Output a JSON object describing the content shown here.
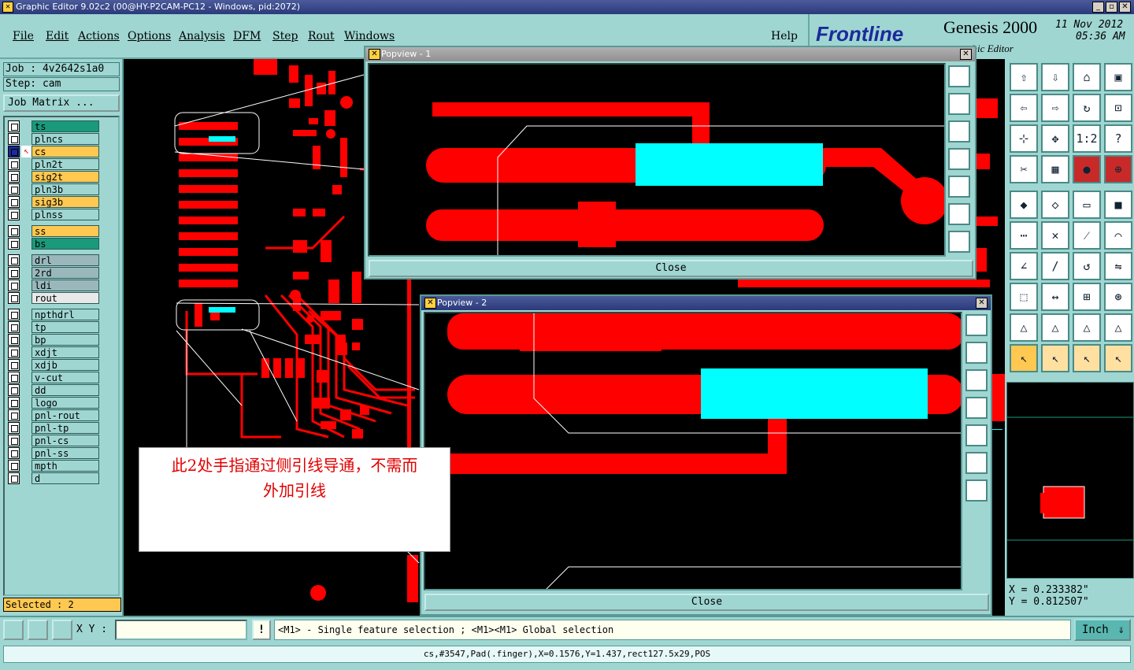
{
  "window": {
    "title": "Graphic Editor 9.02c2 (00@HY-P2CAM-PC12 - Windows, pid:2072)"
  },
  "menu": {
    "items": [
      "File",
      "Edit",
      "Actions",
      "Options",
      "Analysis",
      "DFM",
      "Step",
      "Rout",
      "Windows"
    ],
    "help": "Help"
  },
  "brand": {
    "frontline": "Frontline",
    "genesis": "Genesis 2000",
    "subtitle": "phic Editor",
    "date": "11 Nov 2012",
    "time": "05:36 AM"
  },
  "job": {
    "job_line": "Job : 4v2642s1a0",
    "step_line": "Step: cam",
    "matrix_button": "Job Matrix ..."
  },
  "layers": [
    {
      "name": "ts",
      "color": "#1a9a7a"
    },
    {
      "name": "plncs",
      "color": "#9fd6d2"
    },
    {
      "name": "cs",
      "color": "#ffc850",
      "active": true
    },
    {
      "name": "pln2t",
      "color": "#9fd6d2"
    },
    {
      "name": "sig2t",
      "color": "#ffc850"
    },
    {
      "name": "pln3b",
      "color": "#9fd6d2"
    },
    {
      "name": "sig3b",
      "color": "#ffc850"
    },
    {
      "name": "plnss",
      "color": "#9fd6d2"
    },
    {
      "name": "ss",
      "color": "#ffc850"
    },
    {
      "name": "bs",
      "color": "#1a9a7a"
    },
    {
      "name": "drl",
      "color": "#9ab8bc"
    },
    {
      "name": "2rd",
      "color": "#9ab8bc"
    },
    {
      "name": "ldi",
      "color": "#9ab8bc"
    },
    {
      "name": "rout",
      "color": "#e8e8e8"
    },
    {
      "name": "npthdrl",
      "color": "#9fd6d2"
    },
    {
      "name": "tp",
      "color": "#9fd6d2"
    },
    {
      "name": "bp",
      "color": "#9fd6d2"
    },
    {
      "name": "xdjt",
      "color": "#9fd6d2"
    },
    {
      "name": "xdjb",
      "color": "#9fd6d2"
    },
    {
      "name": "v-cut",
      "color": "#9fd6d2"
    },
    {
      "name": "dd",
      "color": "#9fd6d2"
    },
    {
      "name": "logo",
      "color": "#9fd6d2"
    },
    {
      "name": "pnl-rout",
      "color": "#9fd6d2"
    },
    {
      "name": "pnl-tp",
      "color": "#9fd6d2"
    },
    {
      "name": "pnl-cs",
      "color": "#9fd6d2"
    },
    {
      "name": "pnl-ss",
      "color": "#9fd6d2"
    },
    {
      "name": "mpth",
      "color": "#9fd6d2"
    },
    {
      "name": "d",
      "color": "#9fd6d2"
    }
  ],
  "selected": "Selected : 2",
  "popup1": {
    "title": "Popview - 1",
    "close": "Close"
  },
  "popup2": {
    "title": "Popview - 2",
    "close": "Close"
  },
  "annotation": {
    "line1": "此2处手指通过侧引线导通，不需而",
    "line2": "外加引线"
  },
  "toolbar_icons": [
    "home-icon",
    "arrow-down-icon",
    "house-icon",
    "window-icon",
    "arrow-left-icon",
    "arrow-right-icon",
    "redraw-icon",
    "snap-icon",
    "fit-icon",
    "center-icon",
    "scale-1-2-icon",
    "help-icon",
    "measure-icon",
    "grid-icon",
    "layers-icon",
    "layer-settings-icon",
    "pad-icon",
    "shape-icon",
    "ruler-icon",
    "dot-icon",
    "net-icon",
    "cross-icon",
    "line-icon",
    "arc-icon",
    "angle-icon",
    "slash-icon",
    "rotate-icon",
    "mirror-icon",
    "select-icon",
    "arrow-icon",
    "box-icon",
    "circles-icon",
    "triangle-icon",
    "triangle2-icon",
    "triangle3-icon",
    "triangle4-icon",
    "pointer-icon",
    "pointer2-icon",
    "pointer3-icon",
    "pointer4-icon"
  ],
  "coords": {
    "x": "X = 0.233382\"",
    "y": "Y = 0.812507\""
  },
  "cmdbar": {
    "xy_label": "X Y :",
    "xy_value": "",
    "warn": "!",
    "hint": "<M1> - Single feature selection ; <M1><M1> Global selection",
    "units": "Inch"
  },
  "status": "cs,#3547,Pad(.finger),X=0.1576,Y=1.437,rect127.5x29,POS"
}
